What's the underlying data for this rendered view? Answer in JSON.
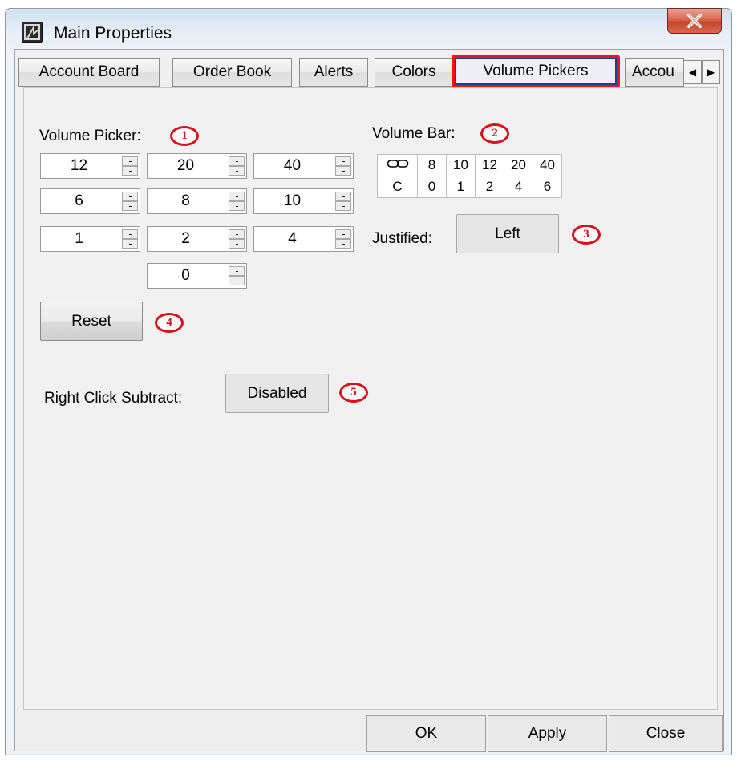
{
  "window": {
    "title": "Main Properties",
    "close_glyph": "X",
    "app_icon": "app-logo-icon"
  },
  "tabs": [
    {
      "label": "Account Board",
      "active": false
    },
    {
      "label": "Order Book",
      "active": false
    },
    {
      "label": "Alerts",
      "active": false
    },
    {
      "label": "Colors",
      "active": false
    },
    {
      "label": "Volume Pickers",
      "active": true
    },
    {
      "label": "Accou",
      "active": false
    }
  ],
  "tab_scroll": {
    "left_glyph": "◀",
    "right_glyph": "▶"
  },
  "volume_picker": {
    "label": "Volume Picker:",
    "badge": "1",
    "values": [
      [
        "12",
        "20",
        "40"
      ],
      [
        "6",
        "8",
        "10"
      ],
      [
        "1",
        "2",
        "4"
      ],
      [
        "0"
      ]
    ]
  },
  "volume_bar": {
    "label": "Volume Bar:",
    "badge": "2",
    "link_icon": "chain-link-icon",
    "top_row": [
      "8",
      "10",
      "12",
      "20",
      "40"
    ],
    "bottom_row": [
      "C",
      "0",
      "1",
      "2",
      "4",
      "6"
    ]
  },
  "justified": {
    "label": "Justified:",
    "value": "Left",
    "badge": "3"
  },
  "reset": {
    "label": "Reset",
    "badge": "4"
  },
  "right_click_subtract": {
    "label": "Right Click Subtract:",
    "value": "Disabled",
    "badge": "5"
  },
  "footer": {
    "ok": "OK",
    "apply": "Apply",
    "close": "Close"
  }
}
